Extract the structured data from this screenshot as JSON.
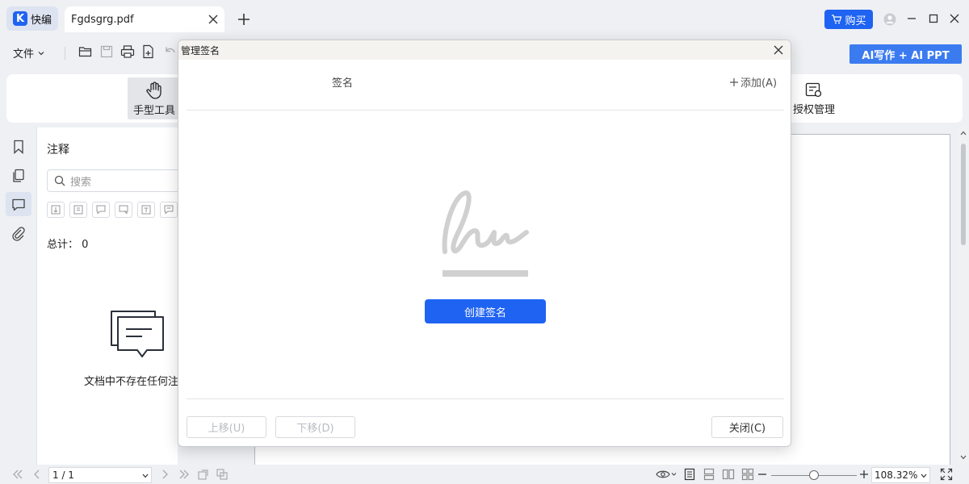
{
  "app": {
    "logo_letter": "K",
    "name": "快编"
  },
  "tab": {
    "filename": "Fgdsgrg.pdf"
  },
  "titlebar": {
    "buy_label": "购买"
  },
  "menubar": {
    "file_label": "文件"
  },
  "ai_button": {
    "label": "AI写作 + AI PPT"
  },
  "ribbon": {
    "hand_tool": "手型工具",
    "auth_manage": "授权管理"
  },
  "panel": {
    "title": "注释",
    "search_placeholder": "搜索",
    "count_label": "总计：",
    "count_value": "0",
    "empty_text": "文档中不存在任何注"
  },
  "statusbar": {
    "page_indicator": "1 / 1",
    "zoom": "108.32%"
  },
  "dialog": {
    "title": "管理签名",
    "column_header": "签名",
    "add_label": "添加(A)",
    "create_label": "创建签名",
    "move_up_label": "上移(U)",
    "move_down_label": "下移(D)",
    "close_label": "关闭(C)"
  },
  "colors": {
    "accent": "#1f63f2",
    "ai_button": "#3b7bf0",
    "illustration": "#d0d0d0"
  }
}
